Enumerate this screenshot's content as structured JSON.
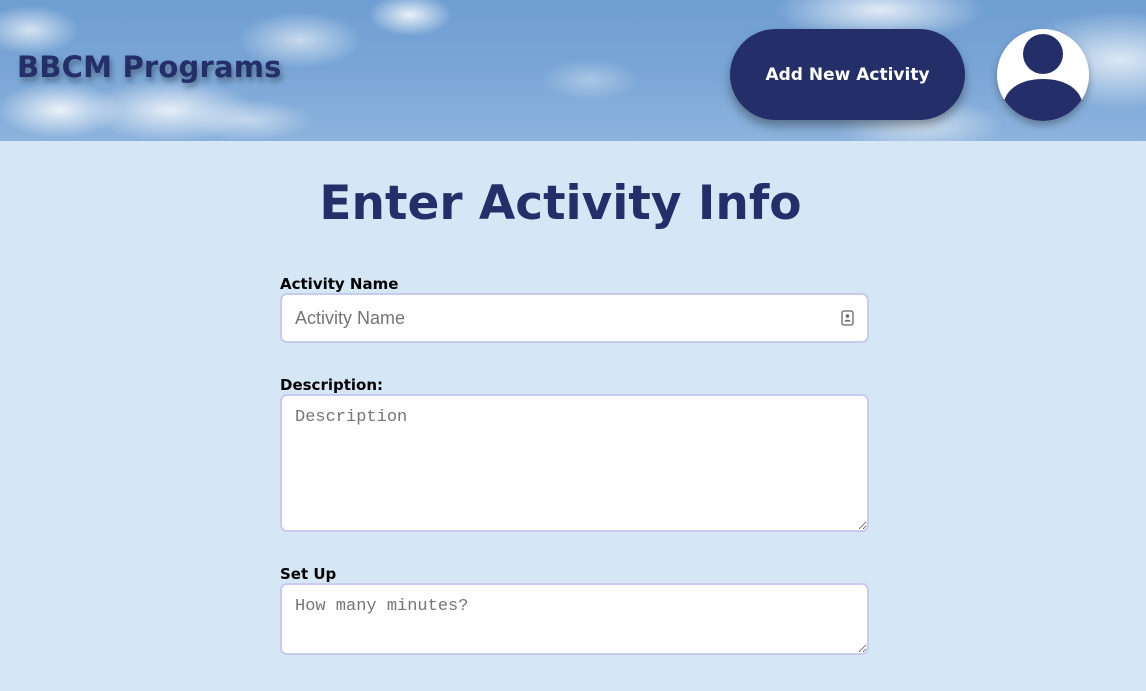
{
  "header": {
    "brand": "BBCM Programs",
    "add_button_label": "Add New Activity"
  },
  "colors": {
    "navy": "#242e68",
    "page_background": "#d5e7f4",
    "field_border": "#c8cbee"
  },
  "icons": {
    "avatar": "user-silhouette-icon",
    "autofill": "contact-card-icon"
  },
  "form": {
    "title": "Enter Activity Info",
    "activity_name": {
      "label": "Activity Name",
      "placeholder": "Activity Name",
      "value": ""
    },
    "description": {
      "label": "Description:",
      "placeholder": "Description",
      "value": ""
    },
    "set_up": {
      "label": "Set Up",
      "placeholder": "How many minutes?",
      "value": ""
    }
  }
}
